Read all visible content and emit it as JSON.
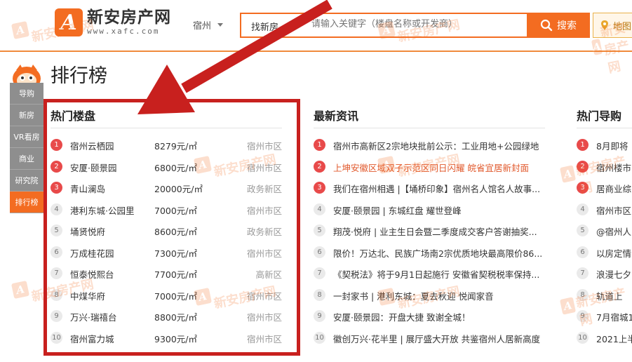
{
  "header": {
    "logo_mark": "A",
    "site_name": "新安房产网",
    "site_url": "www.xafc.com",
    "city": "宿州",
    "search_type": "找新房",
    "search_placeholder": "请输入关键字（楼盘名称或开发商）",
    "search_button": "搜索",
    "map_button": "地图"
  },
  "sidenav": {
    "items": [
      {
        "label": "导购"
      },
      {
        "label": "新房"
      },
      {
        "label": "VR看房"
      },
      {
        "label": "商业"
      },
      {
        "label": "研究院"
      },
      {
        "label": "排行榜"
      }
    ],
    "active_index": 5
  },
  "page_title": "排行榜",
  "hot_projects": {
    "title": "热门楼盘",
    "rows": [
      {
        "rank": "1",
        "name": "宿州云栖园",
        "price": "8279元/㎡",
        "district": "宿州市区"
      },
      {
        "rank": "2",
        "name": "安厦·颐景园",
        "price": "6800元/㎡",
        "district": "宿州市区"
      },
      {
        "rank": "3",
        "name": "青山澜岛",
        "price": "20000元/㎡",
        "district": "政务新区"
      },
      {
        "rank": "4",
        "name": "港利东城·公园里",
        "price": "7000元/㎡",
        "district": "宿州市区"
      },
      {
        "rank": "5",
        "name": "埇贤悦府",
        "price": "8600元/㎡",
        "district": "政务新区"
      },
      {
        "rank": "6",
        "name": "万成桂花园",
        "price": "7300元/㎡",
        "district": "宿州市区"
      },
      {
        "rank": "7",
        "name": "恒泰悦熙台",
        "price": "7700元/㎡",
        "district": "高新区"
      },
      {
        "rank": "8",
        "name": "中煤华府",
        "price": "7000元/㎡",
        "district": "宿州市区"
      },
      {
        "rank": "9",
        "name": "万兴·瑞禧台",
        "price": "8800元/㎡",
        "district": "宿州市区"
      },
      {
        "rank": "10",
        "name": "宿州富力城",
        "price": "9300元/㎡",
        "district": "宿州市区"
      }
    ]
  },
  "latest_news": {
    "title": "最新资讯",
    "rows": [
      {
        "rank": "1",
        "text": "宿州市高新区2宗地块批前公示：工业用地+公园绿地"
      },
      {
        "rank": "2",
        "text": "上坤安徽区域双子示范区同日闪耀 皖省宜居新封面"
      },
      {
        "rank": "3",
        "text": "我们在宿州相遇 |【埇桥印象】宿州名人馆名人故事..."
      },
      {
        "rank": "4",
        "text": "安厦·颐景园 | 东城红盘 耀世登峰"
      },
      {
        "rank": "5",
        "text": "翔茂·悦府 | 业主生日会暨二季度成交客户答谢抽奖..."
      },
      {
        "rank": "6",
        "text": "限价！万达北、民族广场南2宗优质地块最高限价86..."
      },
      {
        "rank": "7",
        "text": "《契税法》将于9月1日起施行 安徽省契税税率保持..."
      },
      {
        "rank": "8",
        "text": "一封家书 | 港利东城：夏去秋迎 悦闻家音"
      },
      {
        "rank": "9",
        "text": "安厦·颐景园：开盘大捷 致谢全城！"
      },
      {
        "rank": "10",
        "text": "徽创万兴·花半里 | 展厅盛大开放 共鉴宿州人居新高度"
      }
    ]
  },
  "hot_guides": {
    "title": "热门导购",
    "rows": [
      {
        "rank": "1",
        "text": "8月即将"
      },
      {
        "rank": "2",
        "text": "宿州楼市"
      },
      {
        "rank": "3",
        "text": "居商业综"
      },
      {
        "rank": "4",
        "text": "宿州市区"
      },
      {
        "rank": "5",
        "text": "@宿州人"
      },
      {
        "rank": "6",
        "text": "以房定情"
      },
      {
        "rank": "7",
        "text": "浪漫七夕"
      },
      {
        "rank": "8",
        "text": "轨道上"
      },
      {
        "rank": "9",
        "text": "7月宿城1"
      },
      {
        "rank": "10",
        "text": "2021上半"
      }
    ]
  },
  "watermark": {
    "mark": "A",
    "text": "新安房产网"
  },
  "colors": {
    "brand": "#f36c21",
    "highlight": "#c8201e",
    "hot_rank": "#e84a4a"
  }
}
